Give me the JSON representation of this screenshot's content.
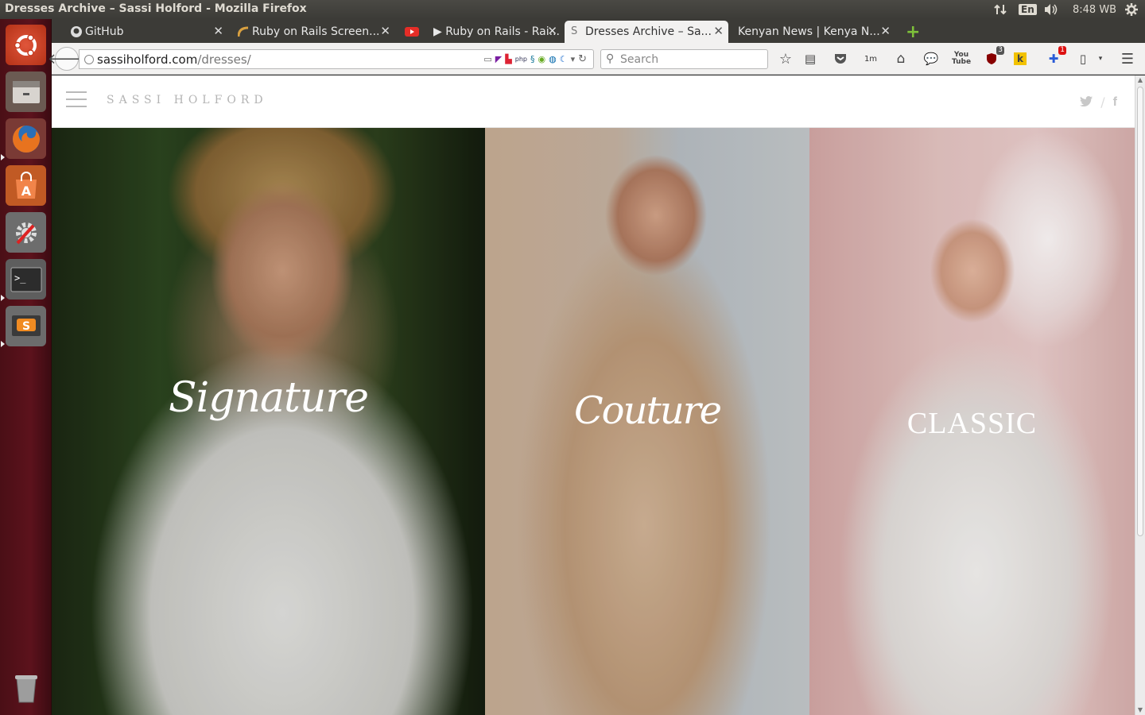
{
  "window": {
    "title": "Dresses Archive – Sassi Holford - Mozilla Firefox"
  },
  "indicators": {
    "keyboard": "En",
    "clock": "8:48 WB"
  },
  "tabs": [
    {
      "label": "GitHub",
      "icon": "github-icon"
    },
    {
      "label": "Ruby on Rails Screen...",
      "icon": "rails-icon"
    },
    {
      "label": "▶ Ruby on Rails - Rai...",
      "icon": "youtube-icon"
    },
    {
      "label": "Dresses Archive – Sa...",
      "icon": "sassi-icon",
      "active": true
    },
    {
      "label": "Kenyan News | Kenya N...",
      "icon": "none"
    }
  ],
  "navbar": {
    "url_host": "sassiholford.com",
    "url_path": "/dresses/",
    "search_placeholder": "Search",
    "badges": {
      "ublock": "3",
      "notifications": "1"
    },
    "onemore": "1m"
  },
  "site": {
    "logo": "SASSI HOLFORD",
    "panels": [
      {
        "label": "Signature"
      },
      {
        "label": "Couture"
      },
      {
        "label": "CLASSIC"
      }
    ]
  },
  "colors": {
    "launcher": "#5c121c",
    "titlebar": "#3c3b37",
    "active_tab": "#f2f1f0"
  }
}
